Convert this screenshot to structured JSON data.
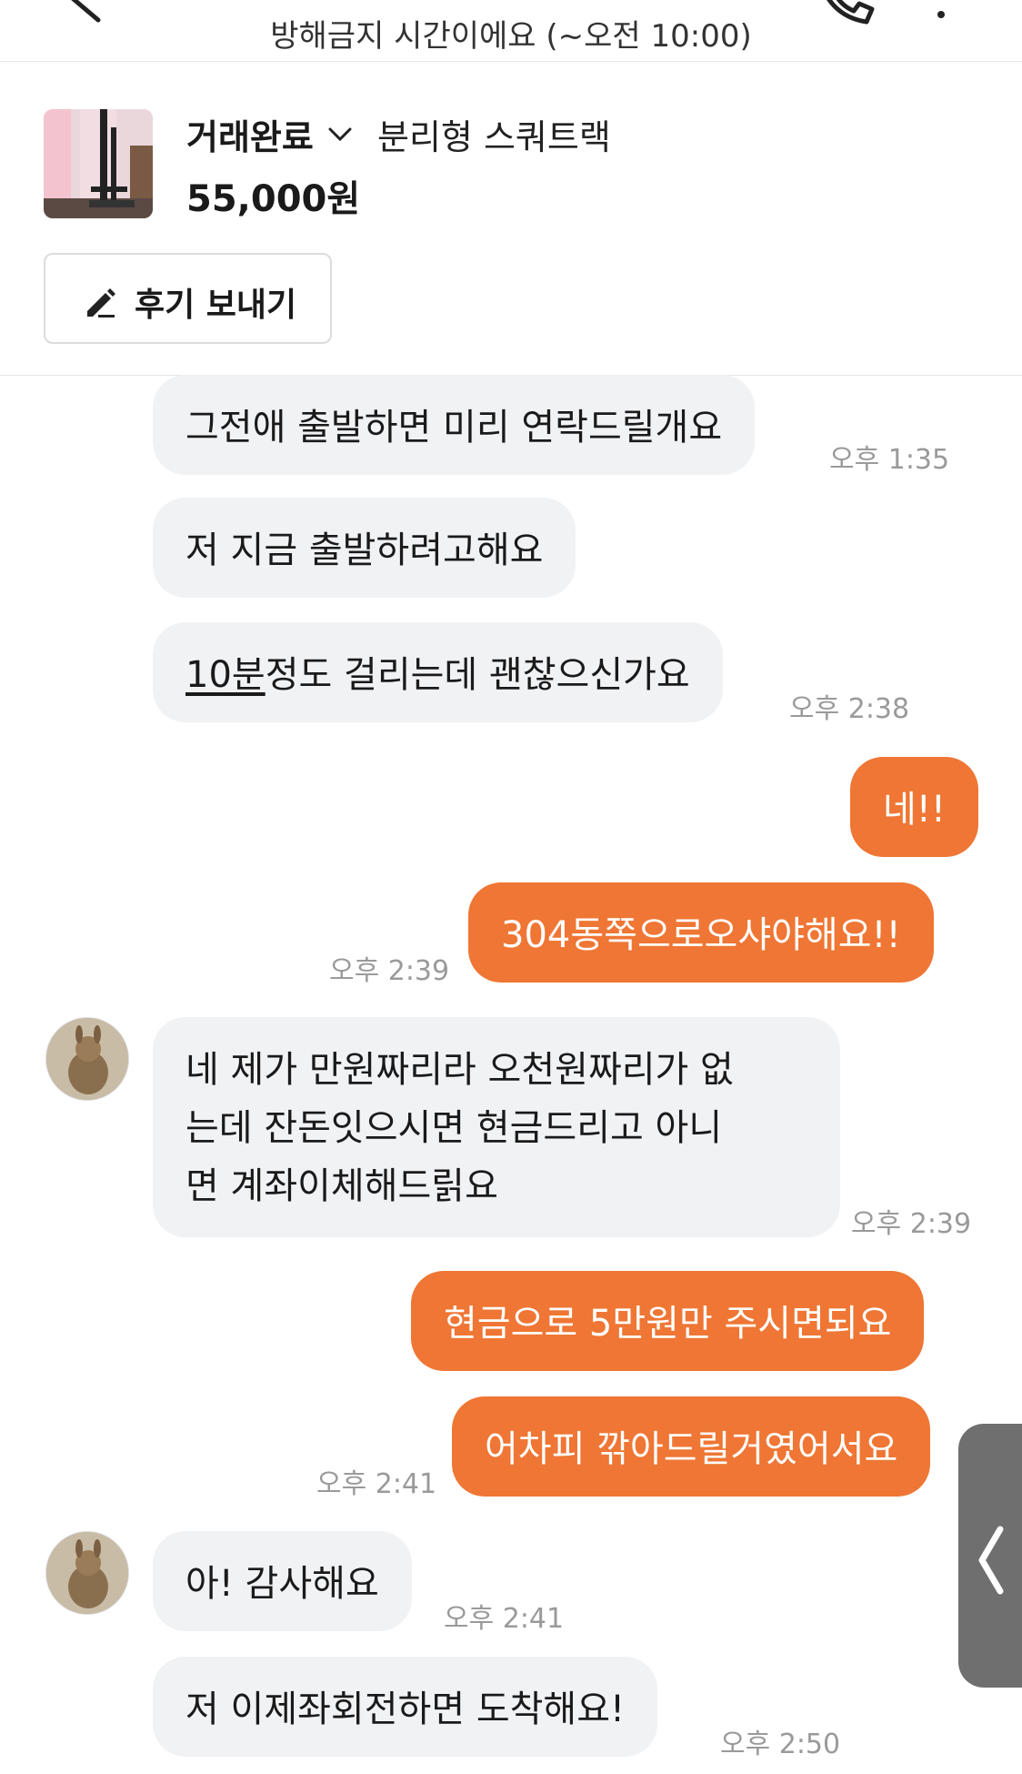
{
  "header": {
    "dnd_notice": "방해금지 시간이에요 (~오전 10:00)"
  },
  "product": {
    "status": "거래완료",
    "title": "분리형 스쿼트랙",
    "price": "55,000원",
    "review_button": "후기 보내기"
  },
  "messages": [
    {
      "text": "그전애 출발하면 미리 연락드릴개요",
      "time": "오후 1:35"
    },
    {
      "text": "저 지금 출발하려고해요"
    },
    {
      "text_underlined": "10분",
      "text": "정도 걸리는데 괜찮으신가요",
      "time": "오후 2:38"
    },
    {
      "text": "네!!"
    },
    {
      "text": "304동쪽으로오샤야해요!!",
      "time": "오후 2:39"
    },
    {
      "lines": [
        "네 제가 만원짜리라 오천원짜리가 없",
        "는데 잔돈잇으시면 현금드리고 아니",
        "면 계좌이체해드릵요"
      ],
      "time": "오후 2:39"
    },
    {
      "text": "현금으로 5만원만 주시면되요"
    },
    {
      "text": "어차피 깎아드릴거였어서요",
      "time": "오후 2:41"
    },
    {
      "text": "아! 감사해요",
      "time": "오후 2:41"
    },
    {
      "text": "저 이제좌회전하면 도착해요!",
      "time": "오후 2:50"
    }
  ],
  "colors": {
    "outgoing_bubble": "#ef7634",
    "incoming_bubble": "#f1f2f4"
  },
  "icons": [
    "back-icon",
    "phone-icon",
    "more-icon",
    "chevron-down-icon",
    "pencil-icon",
    "chevron-left-icon"
  ]
}
